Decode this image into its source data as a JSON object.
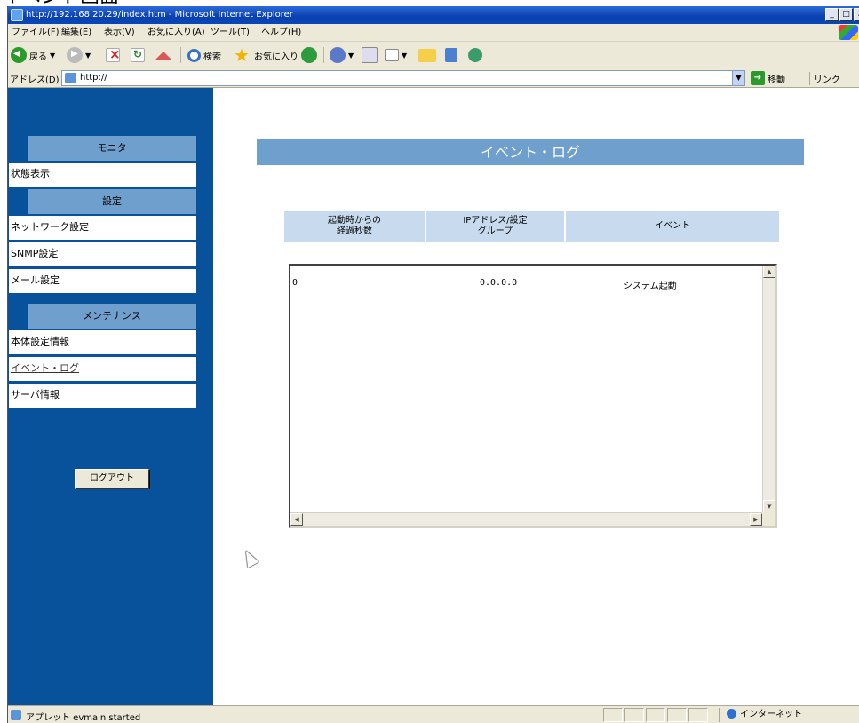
{
  "page_heading": "イベント画面",
  "window": {
    "title": "http://192.168.20.29/index.htm - Microsoft Internet Explorer",
    "buttons": [
      "_",
      "□",
      "×"
    ]
  },
  "menubar": {
    "items": [
      "ファイル(F)",
      "編集(E)",
      "表示(V)",
      "お気に入り(A)",
      "ツール(T)",
      "ヘルプ(H)"
    ]
  },
  "toolbar": {
    "back_label": "戻る",
    "search_label": "検索",
    "favorites_label": "お気に入り"
  },
  "addressbar": {
    "label": "アドレス(D)",
    "url": "http://",
    "go_label": "移動",
    "links_label": "リンク"
  },
  "sidebar": {
    "sections": [
      {
        "label": "モニタ",
        "items": [
          "状態表示"
        ]
      },
      {
        "label": "設定",
        "items": [
          "ネットワーク設定",
          "SNMP設定",
          "メール設定"
        ]
      },
      {
        "label": "メンテナンス",
        "items": [
          "本体設定情報",
          "イベント・ログ",
          "サーバ情報"
        ]
      }
    ],
    "selected_item": "イベント・ログ",
    "logout_label": "ログアウト"
  },
  "main": {
    "title": "イベント・ログ",
    "columns": [
      "起動時からの\n経過秒数",
      "IPアドレス/設定\nグループ",
      "イベント"
    ],
    "rows": [
      {
        "seconds": "0",
        "ip": "0.0.0.0",
        "event": "システム起動"
      }
    ]
  },
  "statusbar": {
    "text": "アプレット evmain started",
    "zone": "インターネット"
  },
  "colors": {
    "sidebar_bg": "#08529c",
    "sidebar_header_bg": "#6f9fcc",
    "title_bg": "#6f9fcc",
    "column_header_bg": "#c8dbee"
  }
}
